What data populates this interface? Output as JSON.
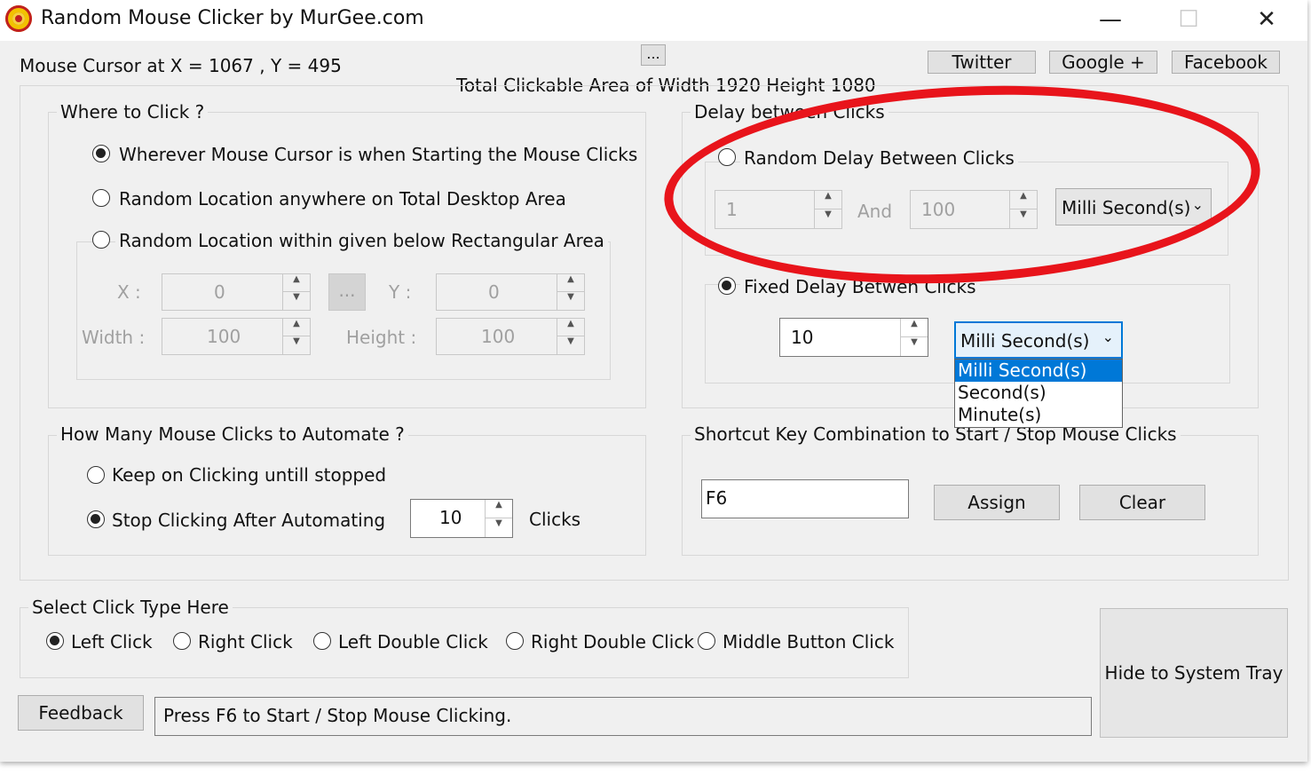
{
  "window": {
    "title": "Random Mouse Clicker by MurGee.com",
    "minimize_glyph": "—",
    "maximize_glyph": "☐",
    "close_glyph": "✕"
  },
  "header": {
    "cursor_text": "Mouse Cursor at X = 1067 , Y = 495",
    "ellipsis": "...",
    "area_text": "Total Clickable Area of Width 1920 Height 1080",
    "twitter": "Twitter",
    "google": "Google +",
    "facebook": "Facebook"
  },
  "where": {
    "title": "Where to Click ?",
    "opt1": "Wherever Mouse Cursor is when Starting the Mouse Clicks",
    "opt2": "Random Location anywhere on Total Desktop Area",
    "opt3": "Random Location within given below Rectangular Area",
    "x_label": "X :",
    "x_value": "0",
    "y_label": "Y :",
    "y_value": "0",
    "pick_button": "...",
    "width_label": "Width :",
    "width_value": "100",
    "height_label": "Height :",
    "height_value": "100"
  },
  "delay": {
    "title": "Delay between Clicks",
    "random_label": "Random Delay Between Clicks",
    "min_value": "1",
    "and_label": "And",
    "max_value": "100",
    "random_unit": "Milli Second(s)",
    "fixed_label": "Fixed Delay Betwen Clicks",
    "fixed_value": "10",
    "fixed_unit": "Milli Second(s)",
    "options": [
      "Milli Second(s)",
      "Second(s)",
      "Minute(s)"
    ]
  },
  "count": {
    "title": "How Many Mouse Clicks to Automate ?",
    "keep_label": "Keep on Clicking untill stopped",
    "stop_label": "Stop Clicking After Automating",
    "clicks_value": "10",
    "clicks_unit": "Clicks"
  },
  "shortcut": {
    "title": "Shortcut Key Combination to Start / Stop Mouse Clicks",
    "key_value": "F6",
    "assign": "Assign",
    "clear": "Clear"
  },
  "click_type": {
    "title": "Select Click Type Here",
    "left": "Left Click",
    "right": "Right Click",
    "left_double": "Left Double Click",
    "right_double": "Right Double Click",
    "middle": "Middle Button Click"
  },
  "footer": {
    "feedback": "Feedback",
    "status": "Press F6 to Start / Stop Mouse Clicking.",
    "hide": "Hide to System Tray"
  },
  "colors": {
    "annotation": "#e8141b",
    "selection": "#0078d7"
  }
}
